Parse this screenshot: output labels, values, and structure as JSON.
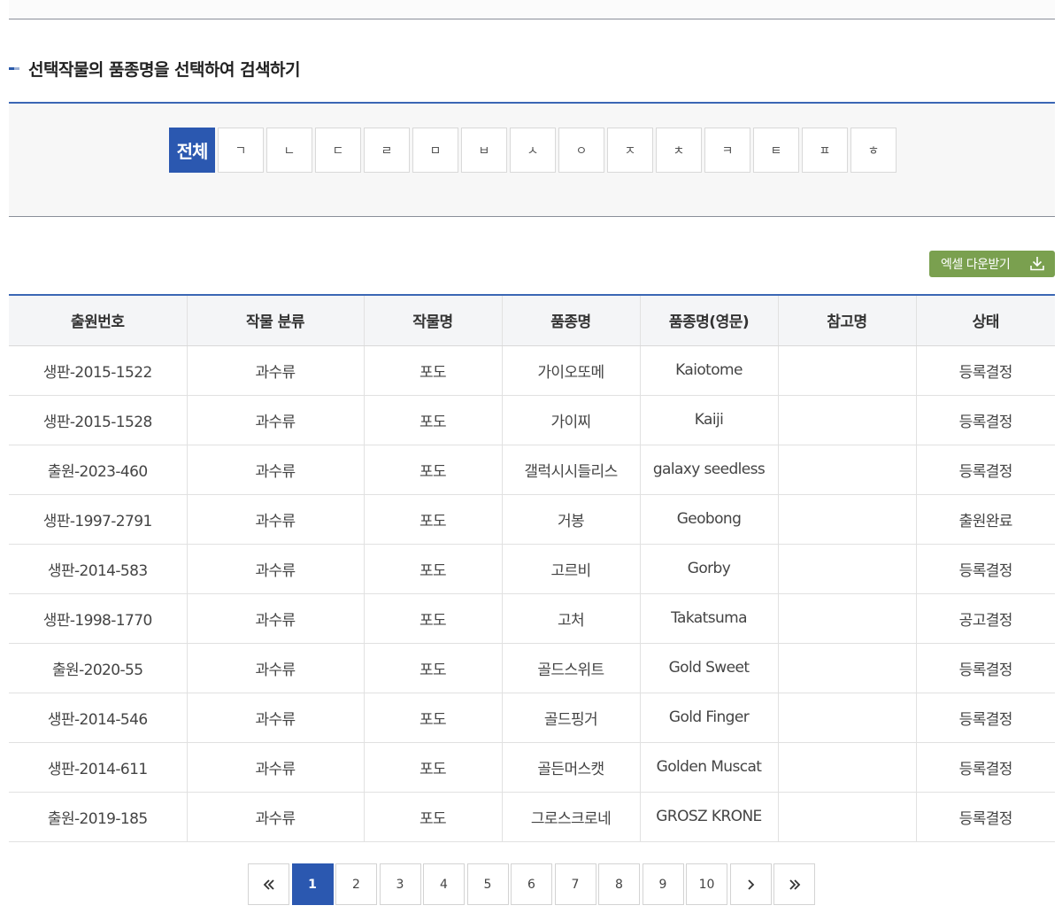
{
  "section": {
    "title": "선택작물의 품종명을 선택하여 검색하기"
  },
  "filters": [
    {
      "label": "전체",
      "active": true
    },
    {
      "label": "ㄱ"
    },
    {
      "label": "ㄴ"
    },
    {
      "label": "ㄷ"
    },
    {
      "label": "ㄹ"
    },
    {
      "label": "ㅁ"
    },
    {
      "label": "ㅂ"
    },
    {
      "label": "ㅅ"
    },
    {
      "label": "ㅇ"
    },
    {
      "label": "ㅈ"
    },
    {
      "label": "ㅊ"
    },
    {
      "label": "ㅋ"
    },
    {
      "label": "ㅌ"
    },
    {
      "label": "ㅍ"
    },
    {
      "label": "ㅎ"
    }
  ],
  "excel": {
    "label": "엑셀 다운받기",
    "icon": "download-icon"
  },
  "table": {
    "headers": [
      "출원번호",
      "작물 분류",
      "작물명",
      "품종명",
      "품종명(영문)",
      "참고명",
      "상태"
    ],
    "rows": [
      [
        "생판-2015-1522",
        "과수류",
        "포도",
        "가이오또메",
        "Kaiotome",
        "",
        "등록결정"
      ],
      [
        "생판-2015-1528",
        "과수류",
        "포도",
        "가이찌",
        "Kaiji",
        "",
        "등록결정"
      ],
      [
        "출원-2023-460",
        "과수류",
        "포도",
        "갤럭시시들리스",
        "galaxy seedless",
        "",
        "등록결정"
      ],
      [
        "생판-1997-2791",
        "과수류",
        "포도",
        "거봉",
        "Geobong",
        "",
        "출원완료"
      ],
      [
        "생판-2014-583",
        "과수류",
        "포도",
        "고르비",
        "Gorby",
        "",
        "등록결정"
      ],
      [
        "생판-1998-1770",
        "과수류",
        "포도",
        "고처",
        "Takatsuma",
        "",
        "공고결정"
      ],
      [
        "출원-2020-55",
        "과수류",
        "포도",
        "골드스위트",
        "Gold Sweet",
        "",
        "등록결정"
      ],
      [
        "생판-2014-546",
        "과수류",
        "포도",
        "골드핑거",
        "Gold Finger",
        "",
        "등록결정"
      ],
      [
        "생판-2014-611",
        "과수류",
        "포도",
        "골든머스캣",
        "Golden Muscat",
        "",
        "등록결정"
      ],
      [
        "출원-2019-185",
        "과수류",
        "포도",
        "그로스크로네",
        "GROSZ KRONE",
        "",
        "등록결정"
      ]
    ]
  },
  "pagination": {
    "first_icon": "double-chevron-left-icon",
    "pages": [
      "1",
      "2",
      "3",
      "4",
      "5",
      "6",
      "7",
      "8",
      "9",
      "10"
    ],
    "current": "1",
    "next_icon": "chevron-right-icon",
    "last_icon": "double-chevron-right-icon"
  }
}
